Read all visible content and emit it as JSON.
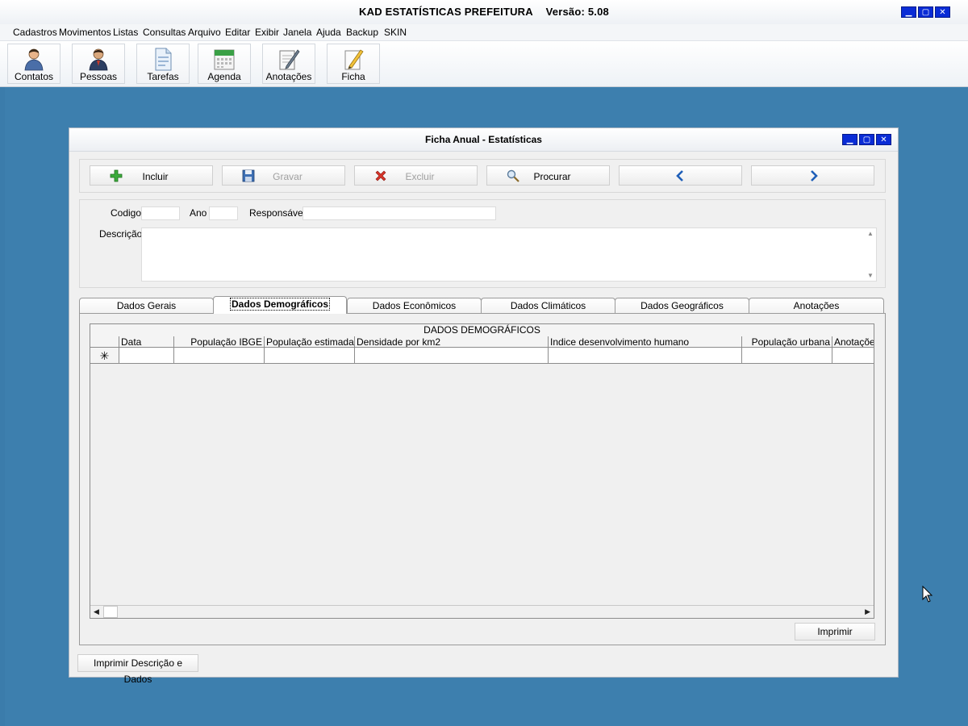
{
  "app": {
    "title_name": "KAD ESTATÍSTICAS PREFEITURA",
    "title_version": "Versão: 5.08"
  },
  "menu": [
    "Cadastros",
    "Movimentos",
    "Listas",
    "Consultas",
    "Arquivo",
    "Editar",
    "Exibir",
    "Janela",
    "Ajuda",
    "Backup",
    "SKIN"
  ],
  "toolbar": [
    {
      "label": "Contatos",
      "icon": "person-icon"
    },
    {
      "label": "Pessoas",
      "icon": "businessman-icon"
    },
    {
      "label": "Tarefas",
      "icon": "document-icon"
    },
    {
      "label": "Agenda",
      "icon": "calendar-icon"
    },
    {
      "label": "Anotações",
      "icon": "notepad-pen-icon"
    },
    {
      "label": "Ficha",
      "icon": "pencil-paper-icon"
    }
  ],
  "dialog": {
    "title": "Ficha Anual - Estatísticas",
    "actions": {
      "include": "Incluir",
      "save": "Gravar",
      "delete": "Excluir",
      "search": "Procurar"
    },
    "fields": {
      "code_label": "Codigo",
      "code_value": "",
      "year_label": "Ano",
      "year_value": "",
      "responsible_label": "Responsável",
      "responsible_value": "",
      "description_label": "Descrição",
      "description_value": ""
    },
    "tabs": [
      "Dados Gerais",
      "Dados Demográficos",
      "Dados Econômicos",
      "Dados Climáticos",
      "Dados Geográficos",
      "Anotações"
    ],
    "active_tab": "Dados Demográficos",
    "grid": {
      "caption": "DADOS DEMOGRÁFICOS",
      "columns": [
        "Data",
        "População IBGE",
        "População estimada",
        "Densidade por km2",
        "Indice desenvolvimento humano",
        "População urbana",
        "Anotações"
      ],
      "new_row_marker": "✳"
    },
    "print_button": "Imprimir",
    "print_all_button": "Imprimir Descrição e Dados"
  }
}
